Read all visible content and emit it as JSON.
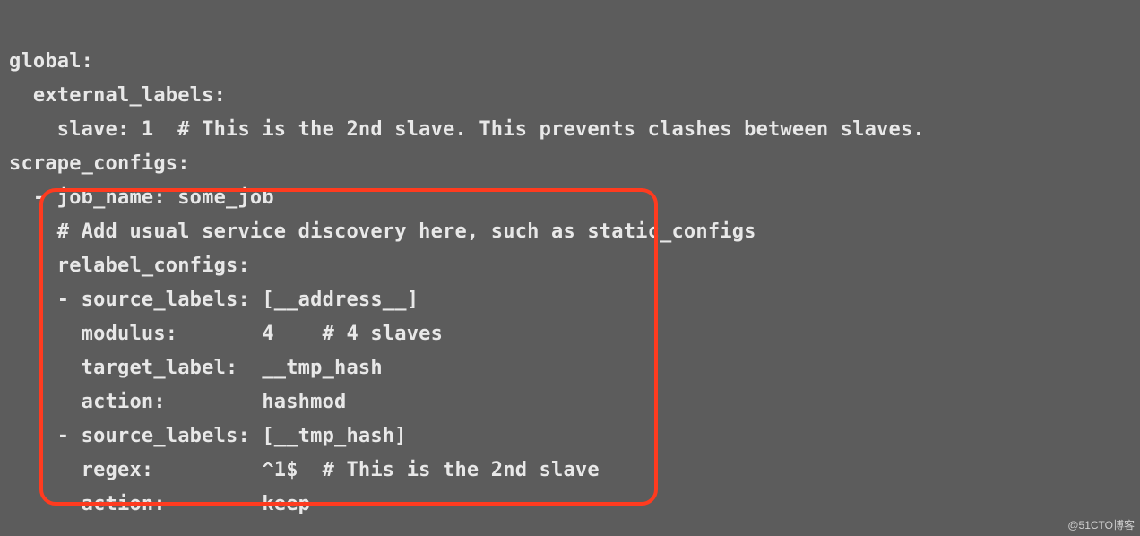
{
  "lines": {
    "l01": "global:",
    "l02": "  external_labels:",
    "l03": "    slave: 1  # This is the 2nd slave. This prevents clashes between slaves.",
    "l04": "scrape_configs:",
    "l05": "  - job_name: some_job",
    "l06": "    # Add usual service discovery here, such as static_configs",
    "l07": "    relabel_configs:",
    "l08": "    - source_labels: [__address__]",
    "l09": "      modulus:       4    # 4 slaves",
    "l10": "      target_label:  __tmp_hash",
    "l11": "      action:        hashmod",
    "l12": "    - source_labels: [__tmp_hash]",
    "l13": "      regex:         ^1$  # This is the 2nd slave",
    "l14": "      action:        keep"
  },
  "watermark": "@51CTO博客"
}
